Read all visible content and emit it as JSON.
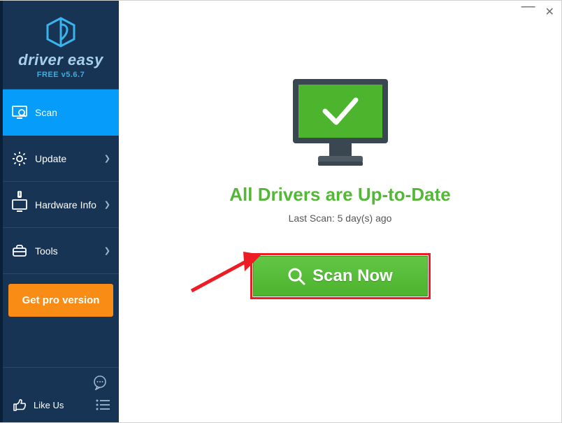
{
  "brand": {
    "name": "driver easy",
    "version": "FREE v5.6.7"
  },
  "sidebar": {
    "items": [
      {
        "label": "Scan"
      },
      {
        "label": "Update"
      },
      {
        "label": "Hardware Info"
      },
      {
        "label": "Tools"
      }
    ],
    "cta": "Get pro version",
    "like": "Like Us"
  },
  "main": {
    "title": "All Drivers are Up-to-Date",
    "subtitle": "Last Scan: 5 day(s) ago",
    "scan_button": "Scan Now"
  }
}
